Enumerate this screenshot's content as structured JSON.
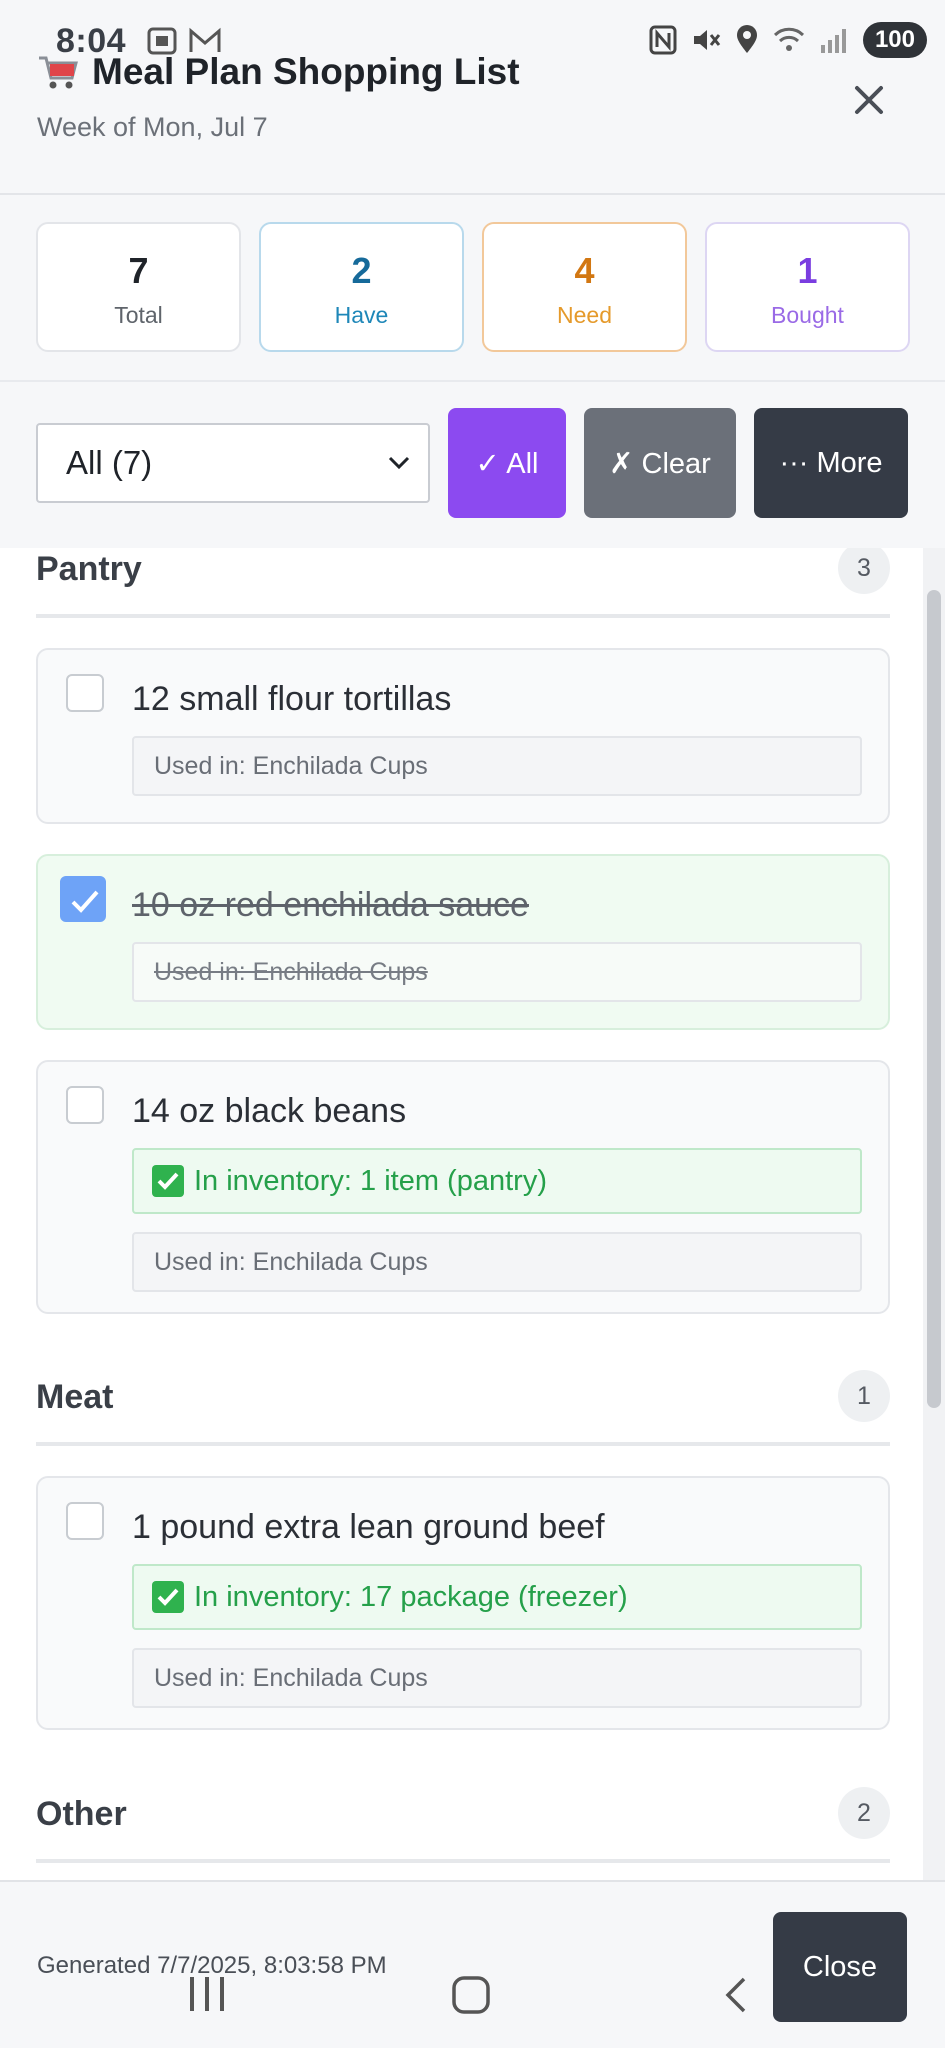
{
  "status_bar": {
    "time": "8:04",
    "battery": "100"
  },
  "header": {
    "title": "Meal Plan Shopping List",
    "subtitle": "Week of Mon, Jul 7"
  },
  "stats": [
    {
      "value": "7",
      "label": "Total"
    },
    {
      "value": "2",
      "label": "Have"
    },
    {
      "value": "4",
      "label": "Need"
    },
    {
      "value": "1",
      "label": "Bought"
    }
  ],
  "controls": {
    "filter_value": "All (7)",
    "all_label": "✓ All",
    "clear_label": "✗ Clear",
    "more_label": "··· More"
  },
  "sections": [
    {
      "title": "Pantry",
      "count": "3",
      "items": [
        {
          "name": "12 small flour tortillas",
          "checked": false,
          "used_in": "Used in: Enchilada Cups"
        },
        {
          "name": "10 oz red enchilada sauce",
          "checked": true,
          "used_in": "Used in: Enchilada Cups"
        },
        {
          "name": "14 oz black beans",
          "checked": false,
          "inventory": "In inventory: 1 item (pantry)",
          "used_in": "Used in: Enchilada Cups"
        }
      ]
    },
    {
      "title": "Meat",
      "count": "1",
      "items": [
        {
          "name": "1 pound extra lean ground beef",
          "checked": false,
          "inventory": "In inventory: 17 package (freezer)",
          "used_in": "Used in: Enchilada Cups"
        }
      ]
    },
    {
      "title": "Other",
      "count": "2",
      "items": []
    }
  ],
  "footer": {
    "generated": "Generated 7/7/2025, 8:03:58 PM",
    "close_label": "Close"
  }
}
